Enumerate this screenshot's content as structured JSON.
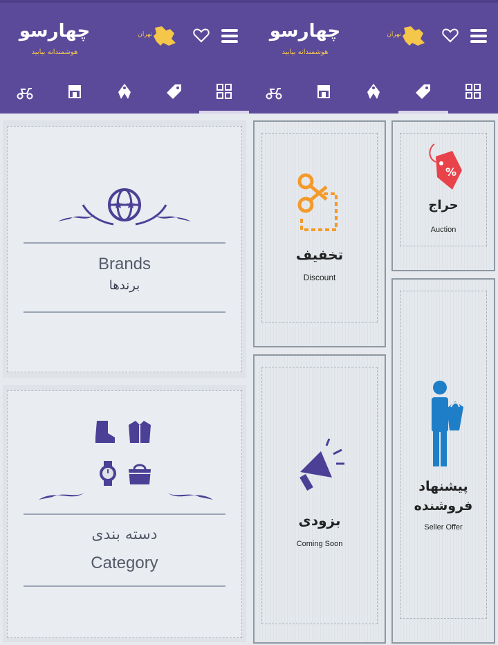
{
  "app": {
    "logo_title": "چهارسو",
    "logo_subtitle": "هوشمندانه بیابید",
    "city": "تهران"
  },
  "icons": {
    "menu": "hamburger-icon",
    "favorite": "heart-icon",
    "location": "iran-map-icon",
    "tabs": [
      "moped-icon",
      "shop-icon",
      "tag-split-icon",
      "price-tag-icon",
      "grid-icon"
    ]
  },
  "colors": {
    "header": "#5b4a9a",
    "accent_gold": "#f4c64a",
    "orange": "#f49a2a",
    "red": "#e8434a",
    "blue": "#1e7fc8",
    "purple": "#4c3f96"
  },
  "left": {
    "brands": {
      "title_en": "Brands",
      "title_fa": "برندها"
    },
    "category": {
      "title_fa": "دسته بندی",
      "title_en": "Category"
    }
  },
  "right": {
    "auction": {
      "title_fa": "حراج",
      "title_en": "Auction"
    },
    "discount": {
      "title_fa": "تخفیف",
      "title_en": "Discount"
    },
    "seller_offer": {
      "title_fa_1": "پیشنهاد",
      "title_fa_2": "فروشنده",
      "title_en": "Seller Offer"
    },
    "coming_soon": {
      "title_fa": "بزودی",
      "title_en": "Coming Soon"
    }
  }
}
